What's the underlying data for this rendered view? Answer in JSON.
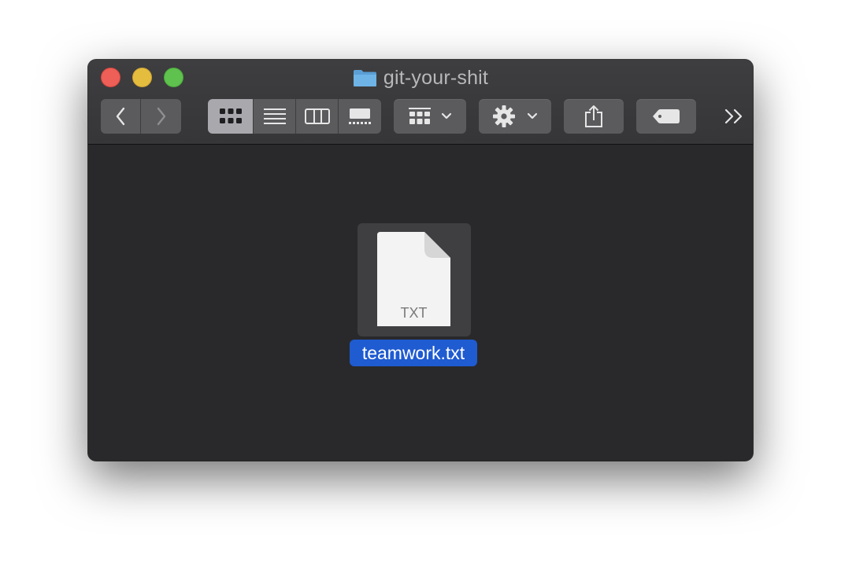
{
  "window": {
    "title": "git-your-shit",
    "folder_icon": "folder-icon"
  },
  "toolbar": {
    "back": "chevron-left-icon",
    "forward": "chevron-right-icon",
    "view_modes": [
      "icon-view",
      "list-view",
      "column-view",
      "gallery-view"
    ],
    "active_view": "icon-view",
    "group": "group-by-icon",
    "action": "gear-icon",
    "share": "share-icon",
    "tags": "tag-icon",
    "overflow": "overflow-icon"
  },
  "files": [
    {
      "name": "teamwork.txt",
      "ext": "TXT",
      "selected": true
    }
  ],
  "colors": {
    "selection": "#1f5bd1",
    "close": "#ed5f57",
    "minimize": "#e5bd3e",
    "maximize": "#5fc14e"
  }
}
